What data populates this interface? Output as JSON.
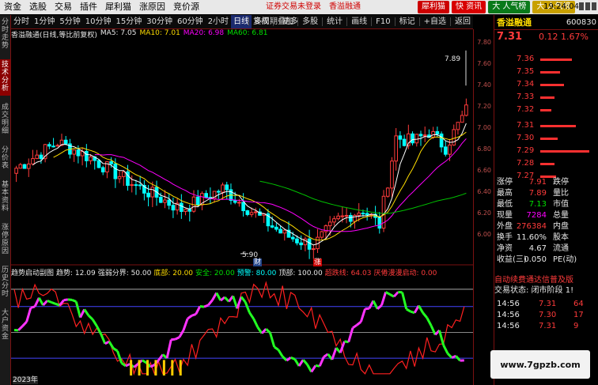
{
  "menu": {
    "items": [
      "资金",
      "选股",
      "交易",
      "插件",
      "犀利猫",
      "涨原因",
      "竞价源"
    ],
    "warning": "证券交易未登录",
    "stock_name": "香溢融通",
    "right_buttons": [
      {
        "label": "犀利猫",
        "color": "#cc0000"
      },
      {
        "label": "快 资讯",
        "color": "#d80000"
      },
      {
        "label": "大 人气榜",
        "color": "#0a7a1a"
      },
      {
        "label": "大 人气榜",
        "color": "#c8a000"
      }
    ],
    "time": "19:24:04"
  },
  "toolbar": {
    "items": [
      "分时",
      "1分钟",
      "5分钟",
      "10分钟",
      "15分钟",
      "30分钟",
      "60分钟",
      "2小时",
      "日线",
      "多周期",
      "更多"
    ],
    "active": "日线",
    "right_items": [
      "复权",
      "叠加",
      "多股",
      "统计",
      "画线",
      "F10",
      "标记",
      "+自选",
      "返回"
    ]
  },
  "sidebar": {
    "tabs": [
      "分时走势",
      "技术分析",
      "成交明细",
      "分价表",
      "基本资料",
      "涨停原因",
      "历史分时",
      "大户资金"
    ],
    "active": "技术分析"
  },
  "chart_header": {
    "title": "香溢融通(日线,等比前复权)",
    "ma5": "MA5: 7.05",
    "ma10": "MA10: 7.01",
    "ma20": "MA20: 6.98",
    "ma60": "MA60: 6.81"
  },
  "indicator_header": {
    "name": "趋势启动副图",
    "trend": "趋势: 12.09",
    "strong": "强弱分界: 50.00",
    "bottom": "底部: 20.00",
    "safe": "安全: 20.00",
    "alert": "预警: 80.00",
    "top": "顶部: 100.00",
    "overbought": "超跌线: 64.03",
    "tail": "厌倦漫漫启动: 0.00"
  },
  "chart_labels": {
    "high": "7.89",
    "low": "5.90",
    "finance": "财",
    "limit_up": "涨",
    "year": "2023年"
  },
  "yaxis_ticks": [
    "7.80",
    "7.60",
    "7.40",
    "7.20",
    "7.00",
    "6.80",
    "6.60",
    "6.40",
    "6.20",
    "6.00"
  ],
  "chart_data": {
    "type": "candlestick",
    "title": "香溢融通(日线,等比前复权)",
    "price_range": [
      5.9,
      7.89
    ],
    "moving_averages": {
      "MA5": 7.05,
      "MA10": 7.01,
      "MA20": 6.98,
      "MA60": 6.81
    },
    "annotations": {
      "high": 7.89,
      "low": 5.9
    }
  },
  "quote": {
    "name": "香溢融通",
    "code": "600830",
    "price": "7.31",
    "change": "0.12",
    "pct": "1.67%",
    "asks": [
      {
        "price": "7.36",
        "vol": "",
        "bar": 40
      },
      {
        "price": "7.35",
        "vol": "",
        "bar": 25
      },
      {
        "price": "7.34",
        "vol": "",
        "bar": 30
      },
      {
        "price": "7.33",
        "vol": "",
        "bar": 18
      },
      {
        "price": "7.32",
        "vol": "",
        "bar": 14
      }
    ],
    "bids": [
      {
        "price": "7.31",
        "vol": "",
        "bar": 45
      },
      {
        "price": "7.30",
        "vol": "",
        "bar": 22
      },
      {
        "price": "7.29",
        "vol": "",
        "bar": 62
      },
      {
        "price": "7.28",
        "vol": "",
        "bar": 18
      },
      {
        "price": "7.27",
        "vol": "",
        "bar": 20
      }
    ],
    "stats": [
      {
        "l1": "涨停",
        "v1": "7.91",
        "c1": "red",
        "l2": "跌停",
        "v2": "",
        "c2": "green"
      },
      {
        "l1": "最高",
        "v1": "7.89",
        "c1": "red",
        "l2": "量比",
        "v2": "",
        "c2": "white"
      },
      {
        "l1": "最低",
        "v1": "7.13",
        "c1": "green",
        "l2": "市值",
        "v2": "",
        "c2": "white"
      },
      {
        "l1": "现量",
        "v1": "7284",
        "c1": "magenta",
        "l2": "总量",
        "v2": "",
        "c2": "white"
      },
      {
        "l1": "外盘",
        "v1": "276384",
        "c1": "red",
        "l2": "内盘",
        "v2": "",
        "c2": "white"
      },
      {
        "l1": "换手",
        "v1": "11.60%",
        "c1": "white",
        "l2": "股本",
        "v2": "",
        "c2": "white"
      },
      {
        "l1": "净资",
        "v1": "4.67",
        "c1": "white",
        "l2": "流通",
        "v2": "",
        "c2": "white"
      },
      {
        "l1": "收益(三)",
        "v1": "0.050",
        "c1": "white",
        "l2": "PE(动)",
        "v2": "",
        "c2": "white"
      }
    ],
    "notice": "自动续费通达信普及版",
    "trade_status": "交易状态: 闭市阶段 1!",
    "ticks": [
      {
        "t": "14:56",
        "p": "7.31",
        "v": "64"
      },
      {
        "t": "14:56",
        "p": "7.30",
        "v": "17"
      },
      {
        "t": "14:56",
        "p": "7.31",
        "v": "9"
      }
    ]
  },
  "watermark": "www.7gpzb.com",
  "colors": {
    "up": "#ff3b3b",
    "down": "#00ffff",
    "ma5": "#ffffff",
    "ma10": "#ffdd00",
    "ma20": "#ff00ff",
    "ma60": "#00c000"
  }
}
